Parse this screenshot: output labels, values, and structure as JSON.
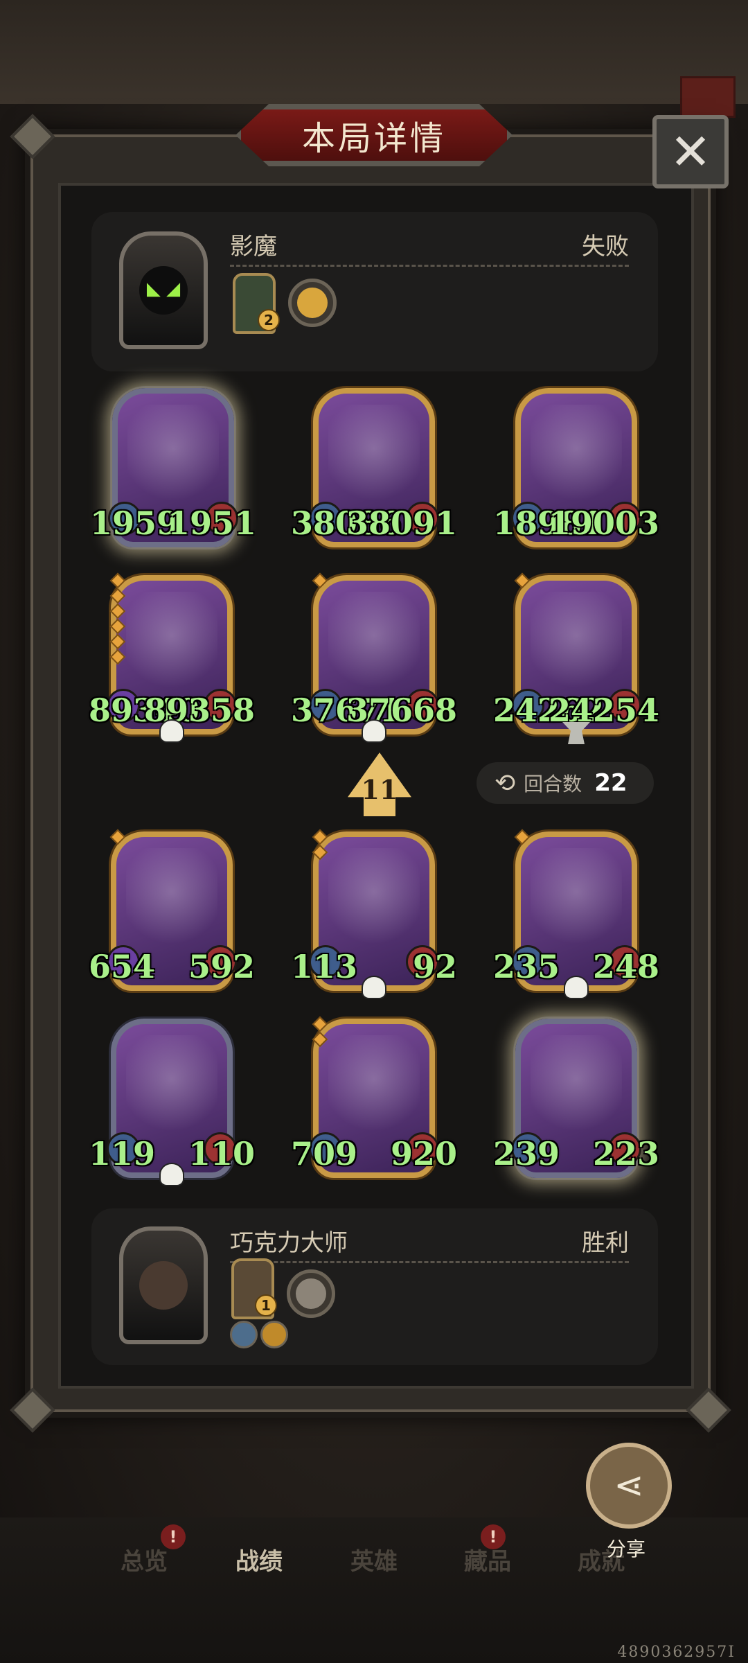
{
  "title": "本局详情",
  "close_icon": "close-icon",
  "opponent": {
    "name": "影魔",
    "result": "失败",
    "badge_level": "2"
  },
  "player": {
    "name": "巧克力大师",
    "result": "胜利",
    "badge_level": "1"
  },
  "opponent_units": [
    {
      "atk": "1959",
      "hp": "1951"
    },
    {
      "atk": "38086",
      "hp": "38091"
    },
    {
      "atk": "18981",
      "hp": "19003"
    },
    {
      "atk": "89340",
      "hp": "89358"
    },
    {
      "atk": "37671",
      "hp": "37668"
    },
    {
      "atk": "24262",
      "hp": "24254"
    }
  ],
  "level_indicator": "11",
  "round": {
    "label": "回合数",
    "value": "22"
  },
  "player_units": [
    {
      "atk": "654",
      "hp": "592"
    },
    {
      "atk": "113",
      "hp": "92"
    },
    {
      "atk": "235",
      "hp": "248"
    },
    {
      "atk": "119",
      "hp": "110"
    },
    {
      "atk": "709",
      "hp": "920"
    },
    {
      "atk": "239",
      "hp": "223"
    }
  ],
  "share_label": "分享",
  "nav": {
    "overview": "总览",
    "record": "战绩",
    "heroes": "英雄",
    "collection": "藏品",
    "achievements": "成就"
  },
  "footer_id": "4890362957I"
}
